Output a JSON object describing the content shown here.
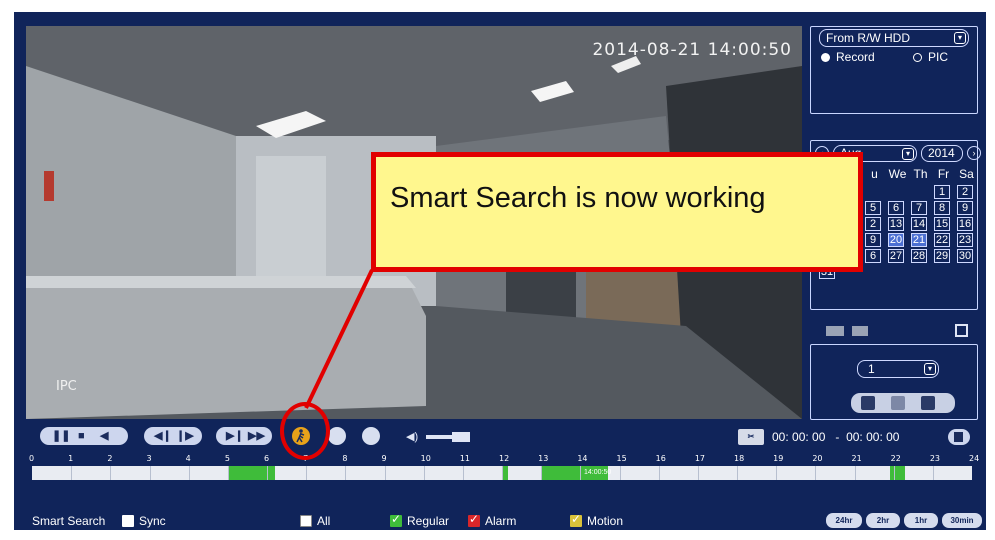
{
  "video": {
    "timestamp": "2014-08-21 14:00:50",
    "camera_label": "IPC"
  },
  "source": {
    "selected": "From R/W HDD",
    "radio_record": "Record",
    "radio_pic": "PIC",
    "selected_radio": "Record"
  },
  "calendar": {
    "month": "Aug",
    "year": "2014",
    "header_visible": [
      "u",
      "We",
      "Th",
      "Fr",
      "Sa"
    ],
    "days": [
      {
        "d": "1",
        "hl": false
      },
      {
        "d": "2",
        "hl": false
      },
      {
        "d": "5",
        "hl": false
      },
      {
        "d": "6",
        "hl": false
      },
      {
        "d": "7",
        "hl": false
      },
      {
        "d": "8",
        "hl": false
      },
      {
        "d": "9",
        "hl": false
      },
      {
        "d": "2",
        "hl": false
      },
      {
        "d": "13",
        "hl": false
      },
      {
        "d": "14",
        "hl": false
      },
      {
        "d": "15",
        "hl": false
      },
      {
        "d": "16",
        "hl": false
      },
      {
        "d": "9",
        "hl": false
      },
      {
        "d": "20",
        "hl": true
      },
      {
        "d": "21",
        "hl": true
      },
      {
        "d": "22",
        "hl": false
      },
      {
        "d": "23",
        "hl": false
      },
      {
        "d": "6",
        "hl": false
      },
      {
        "d": "27",
        "hl": false
      },
      {
        "d": "28",
        "hl": false
      },
      {
        "d": "29",
        "hl": false
      },
      {
        "d": "30",
        "hl": false
      },
      {
        "d": "31",
        "hl": false
      }
    ]
  },
  "channel": {
    "selected": "1"
  },
  "playback": {
    "time_start": "00: 00: 00",
    "time_separator": "-",
    "time_end": "00: 00: 00"
  },
  "timeline": {
    "hours": [
      "0",
      "1",
      "2",
      "3",
      "4",
      "5",
      "6",
      "7",
      "8",
      "9",
      "10",
      "11",
      "12",
      "13",
      "14",
      "15",
      "16",
      "17",
      "18",
      "19",
      "20",
      "21",
      "22",
      "23",
      "24"
    ],
    "hour_marker_text": "14:00:50",
    "recorded_ranges_hours": [
      [
        5.0,
        6.2
      ],
      [
        12.0,
        12.15
      ],
      [
        13.0,
        14.7
      ],
      [
        21.9,
        22.3
      ]
    ]
  },
  "footer": {
    "smart_search": "Smart Search",
    "sync": "Sync",
    "all": "All",
    "regular": "Regular",
    "alarm": "Alarm",
    "motion": "Motion",
    "zoom_24": "24hr",
    "zoom_2": "2hr",
    "zoom_1": "1hr",
    "zoom_30": "30min"
  },
  "colors": {
    "regular": "#3fbc3a",
    "alarm": "#d8262a",
    "motion": "#d9c23a",
    "smart_search_button": "#e7a21a",
    "callout_border": "#e10000",
    "callout_fill": "#fff78e"
  },
  "callout": {
    "text": "Smart Search is now working"
  }
}
